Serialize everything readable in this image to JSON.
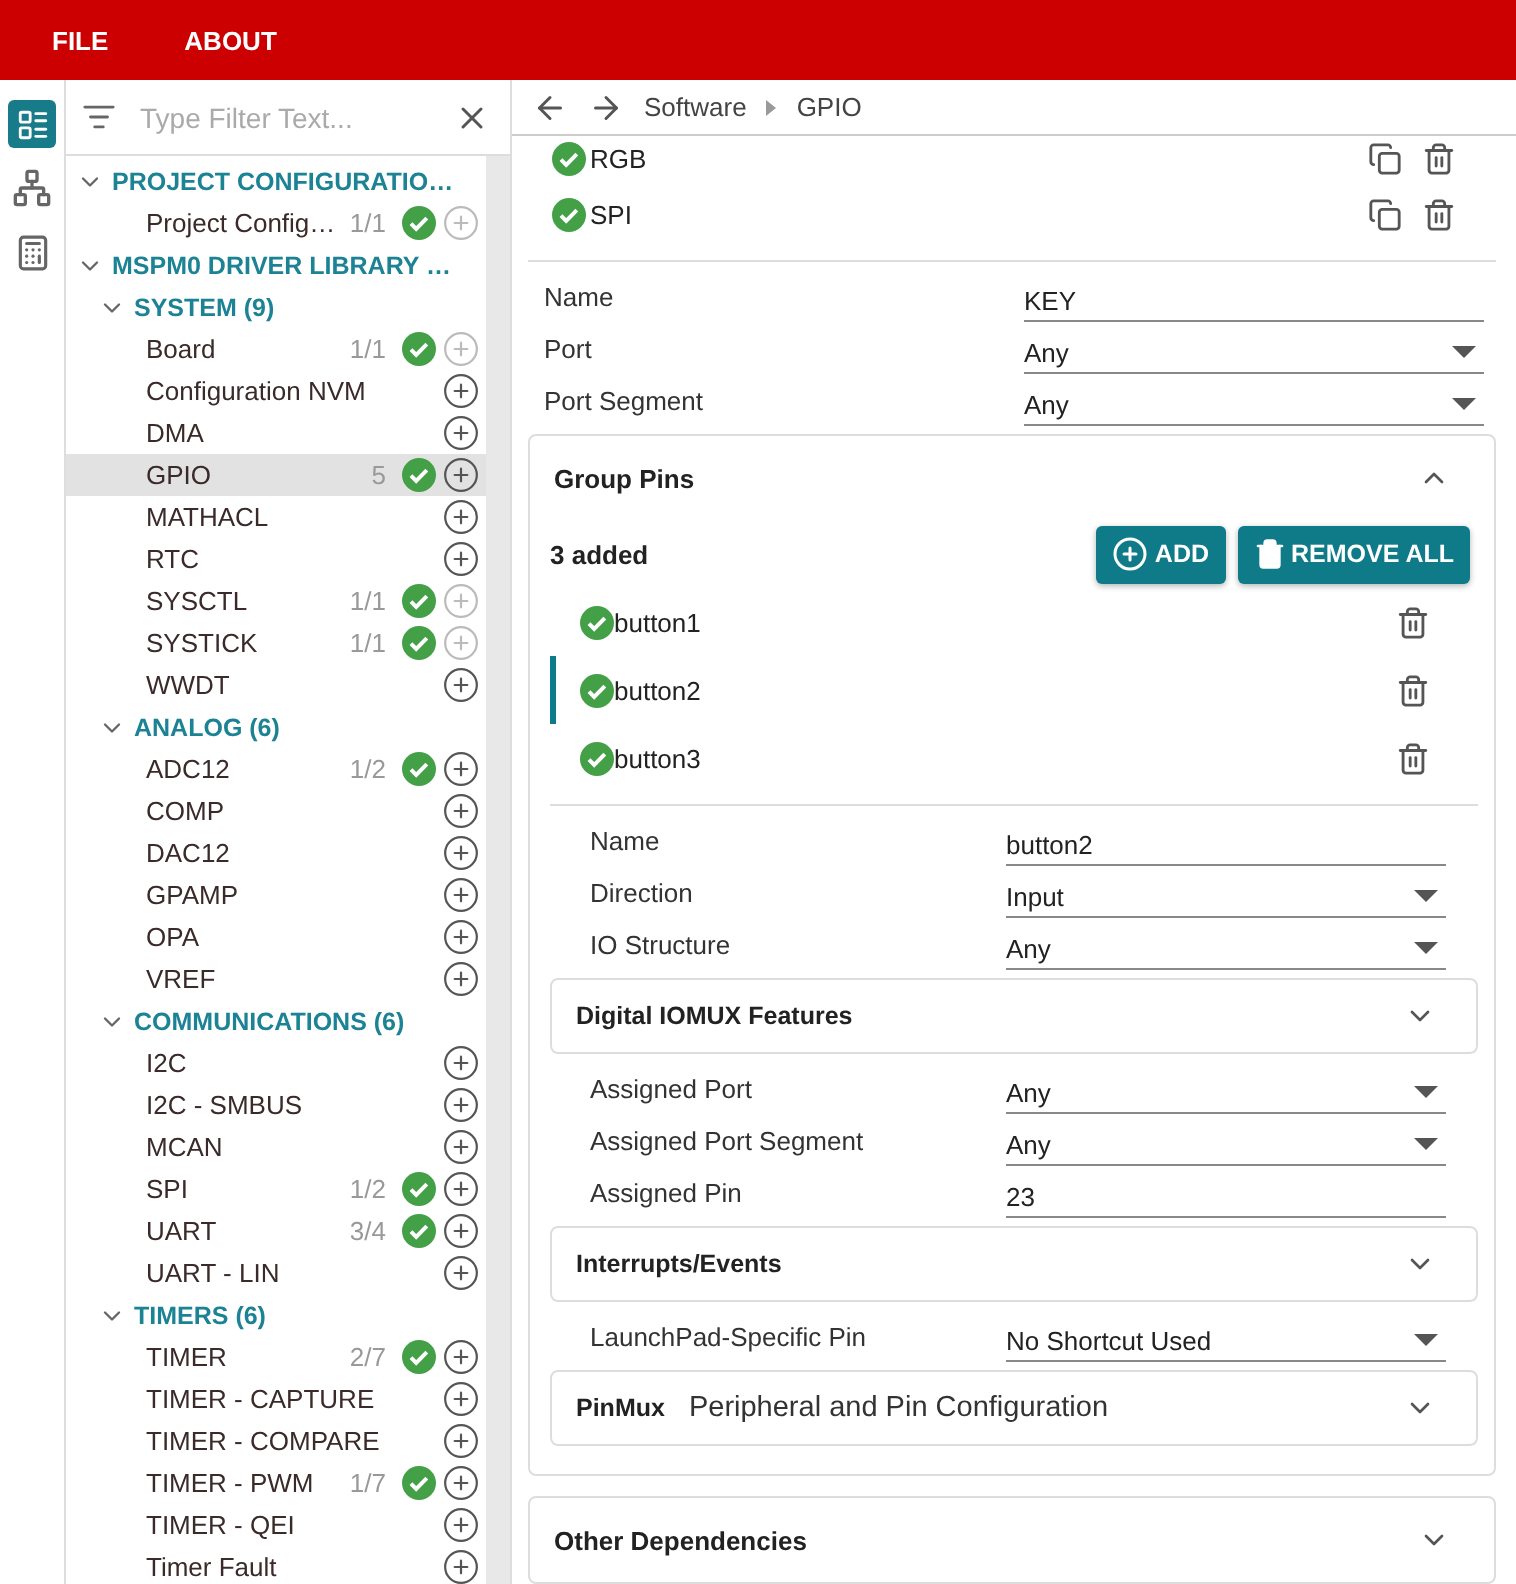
{
  "menu": [
    "FILE",
    "ABOUT"
  ],
  "rail": [
    {
      "kind": "list",
      "selected": true
    },
    {
      "kind": "tree",
      "selected": false
    },
    {
      "kind": "calculator",
      "selected": false
    }
  ],
  "filter": {
    "placeholder": "Type Filter Text..."
  },
  "tree": [
    {
      "label": "PROJECT CONFIGURATIO…",
      "expanded": true,
      "children": [
        {
          "label": "Project Config…",
          "count": "1/1",
          "configured": true,
          "can_add": false,
          "selected": false
        }
      ]
    },
    {
      "label": "MSPM0 DRIVER LIBRARY …",
      "expanded": true,
      "children": [
        {
          "label": "SYSTEM (9)",
          "expanded": true,
          "children": [
            {
              "label": "Board",
              "count": "1/1",
              "configured": true,
              "can_add": false,
              "selected": false
            },
            {
              "label": "Configuration NVM",
              "configured": false,
              "can_add": true,
              "selected": false
            },
            {
              "label": "DMA",
              "configured": false,
              "can_add": true,
              "selected": false
            },
            {
              "label": "GPIO",
              "count": "5",
              "configured": true,
              "can_add": true,
              "selected": true
            },
            {
              "label": "MATHACL",
              "configured": false,
              "can_add": true,
              "selected": false
            },
            {
              "label": "RTC",
              "configured": false,
              "can_add": true,
              "selected": false
            },
            {
              "label": "SYSCTL",
              "count": "1/1",
              "configured": true,
              "can_add": false,
              "selected": false
            },
            {
              "label": "SYSTICK",
              "count": "1/1",
              "configured": true,
              "can_add": false,
              "selected": false
            },
            {
              "label": "WWDT",
              "configured": false,
              "can_add": true,
              "selected": false
            }
          ]
        },
        {
          "label": "ANALOG (6)",
          "expanded": true,
          "children": [
            {
              "label": "ADC12",
              "count": "1/2",
              "configured": true,
              "can_add": true,
              "selected": false
            },
            {
              "label": "COMP",
              "configured": false,
              "can_add": true,
              "selected": false
            },
            {
              "label": "DAC12",
              "configured": false,
              "can_add": true,
              "selected": false
            },
            {
              "label": "GPAMP",
              "configured": false,
              "can_add": true,
              "selected": false
            },
            {
              "label": "OPA",
              "configured": false,
              "can_add": true,
              "selected": false
            },
            {
              "label": "VREF",
              "configured": false,
              "can_add": true,
              "selected": false
            }
          ]
        },
        {
          "label": "COMMUNICATIONS (6)",
          "expanded": true,
          "children": [
            {
              "label": "I2C",
              "configured": false,
              "can_add": true,
              "selected": false
            },
            {
              "label": "I2C - SMBUS",
              "configured": false,
              "can_add": true,
              "selected": false
            },
            {
              "label": "MCAN",
              "configured": false,
              "can_add": true,
              "selected": false
            },
            {
              "label": "SPI",
              "count": "1/2",
              "configured": true,
              "can_add": true,
              "selected": false
            },
            {
              "label": "UART",
              "count": "3/4",
              "configured": true,
              "can_add": true,
              "selected": false
            },
            {
              "label": "UART - LIN",
              "configured": false,
              "can_add": true,
              "selected": false
            }
          ]
        },
        {
          "label": "TIMERS (6)",
          "expanded": true,
          "children": [
            {
              "label": "TIMER",
              "count": "2/7",
              "configured": true,
              "can_add": true,
              "selected": false
            },
            {
              "label": "TIMER - CAPTURE",
              "configured": false,
              "can_add": true,
              "selected": false
            },
            {
              "label": "TIMER - COMPARE",
              "configured": false,
              "can_add": true,
              "selected": false
            },
            {
              "label": "TIMER - PWM",
              "count": "1/7",
              "configured": true,
              "can_add": true,
              "selected": false
            },
            {
              "label": "TIMER - QEI",
              "configured": false,
              "can_add": true,
              "selected": false
            },
            {
              "label": "Timer Fault",
              "configured": false,
              "can_add": true,
              "selected": false
            }
          ]
        }
      ]
    }
  ],
  "breadcrumb": [
    "Software",
    "GPIO"
  ],
  "instances": [
    {
      "name": "RGB",
      "configured": true
    },
    {
      "name": "SPI",
      "configured": true
    }
  ],
  "fields": [
    {
      "label": "Name",
      "value": "KEY",
      "dropdown": false
    },
    {
      "label": "Port",
      "value": "Any",
      "dropdown": true
    },
    {
      "label": "Port Segment",
      "value": "Any",
      "dropdown": true
    }
  ],
  "group_pins": {
    "title": "Group Pins",
    "expanded": true,
    "count_text": "3 added",
    "add_label": "ADD",
    "remove_label": "REMOVE ALL",
    "pins": [
      {
        "name": "button1",
        "configured": true,
        "selected": false
      },
      {
        "name": "button2",
        "configured": true,
        "selected": true
      },
      {
        "name": "button3",
        "configured": true,
        "selected": false
      }
    ],
    "items": [
      {
        "kind": "field",
        "label": "Name",
        "value": "button2",
        "dropdown": false
      },
      {
        "kind": "field",
        "label": "Direction",
        "value": "Input",
        "dropdown": true
      },
      {
        "kind": "field",
        "label": "IO Structure",
        "value": "Any",
        "dropdown": true
      },
      {
        "kind": "section",
        "title": "Digital IOMUX Features",
        "expanded": false
      },
      {
        "kind": "field",
        "label": "Assigned Port",
        "value": "Any",
        "dropdown": true
      },
      {
        "kind": "field",
        "label": "Assigned Port Segment",
        "value": "Any",
        "dropdown": true
      },
      {
        "kind": "field",
        "label": "Assigned Pin",
        "value": "23",
        "dropdown": false
      },
      {
        "kind": "section",
        "title": "Interrupts/Events",
        "expanded": false
      },
      {
        "kind": "field",
        "label": "LaunchPad-Specific Pin",
        "value": "No Shortcut Used",
        "dropdown": true
      },
      {
        "kind": "section",
        "title": "PinMux",
        "subtitle": "Peripheral and Pin Configuration",
        "expanded": false
      }
    ]
  },
  "other": {
    "title": "Other Dependencies",
    "expanded": false
  }
}
